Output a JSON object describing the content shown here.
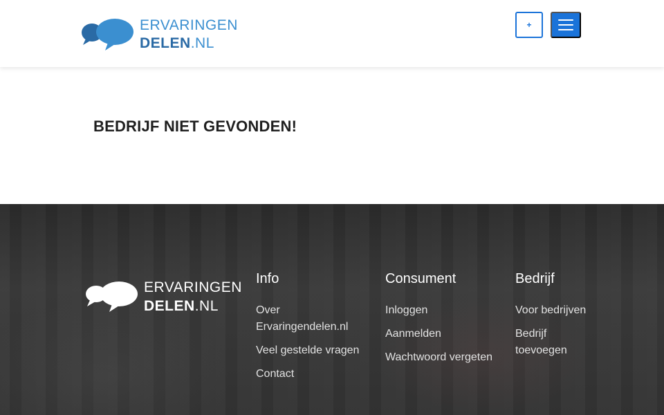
{
  "header": {
    "logo": {
      "line1": "ERVARINGEN",
      "line2_bold": "DELEN",
      "line2_suffix": ".NL"
    },
    "plus_label": "+",
    "menu_icon": "hamburger-menu-icon"
  },
  "main": {
    "title": "BEDRIJF NIET GEVONDEN!"
  },
  "footer": {
    "logo": {
      "line1": "ERVARINGEN",
      "line2_bold": "DELEN",
      "line2_suffix": ".NL"
    },
    "columns": [
      {
        "heading": "Info",
        "links": [
          "Over Ervaringendelen.nl",
          "Veel gestelde vragen",
          "Contact"
        ]
      },
      {
        "heading": "Consument",
        "links": [
          "Inloggen",
          "Aanmelden",
          "Wachtwoord vergeten"
        ]
      },
      {
        "heading": "Bedrijf",
        "links": [
          "Voor bedrijven",
          "Bedrijf toevoegen"
        ]
      }
    ]
  },
  "colors": {
    "brand_blue": "#1a73d9",
    "logo_blue": "#3b8fd0",
    "footer_bg": "#333333"
  }
}
